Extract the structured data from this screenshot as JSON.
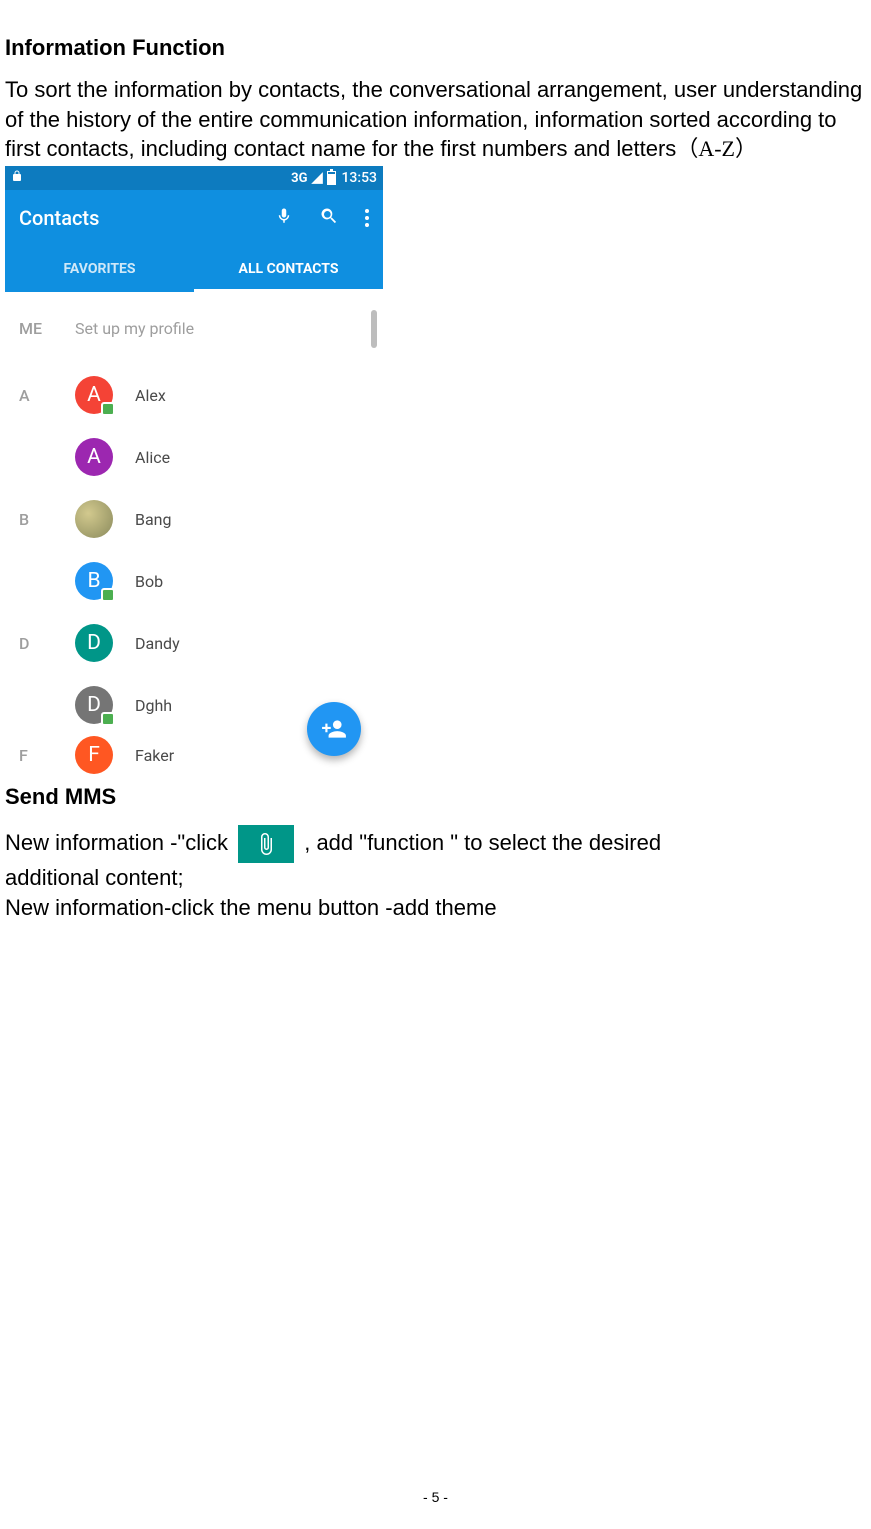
{
  "section1": {
    "heading": "Information Function",
    "paragraph": "To sort the information by contacts, the conversational arrangement, user understanding of the history of the entire communication information, information sorted according to first contacts, including contact name for the first numbers and letters",
    "az_suffix": "（A-Z）"
  },
  "phone": {
    "status": {
      "signal": "3G",
      "time": "13:53"
    },
    "app_title": "Contacts",
    "tabs": {
      "favorites": "FAVORITES",
      "all": "ALL CONTACTS"
    },
    "me_label": "ME",
    "profile_text": "Set up my profile",
    "sections": [
      {
        "letter": "A",
        "items": [
          {
            "name": "Alex",
            "color": "#f44336",
            "initial": "A",
            "badge": true
          },
          {
            "name": "Alice",
            "color": "#9c27b0",
            "initial": "A",
            "badge": false
          }
        ]
      },
      {
        "letter": "B",
        "items": [
          {
            "name": "Bang",
            "color": "#b0a77b",
            "initial": "",
            "badge": false,
            "photo": true
          },
          {
            "name": "Bob",
            "color": "#2196f3",
            "initial": "B",
            "badge": true
          }
        ]
      },
      {
        "letter": "D",
        "items": [
          {
            "name": "Dandy",
            "color": "#009688",
            "initial": "D",
            "badge": false
          },
          {
            "name": "Dghh",
            "color": "#757575",
            "initial": "D",
            "badge": true
          }
        ]
      },
      {
        "letter": "F",
        "items": [
          {
            "name": "Faker",
            "color": "#ff5722",
            "initial": "F",
            "badge": false
          }
        ]
      }
    ]
  },
  "section2": {
    "heading": "Send MMS",
    "line1_a": "New information -\"click ",
    "line1_b": " ,    add \"function    \" to select the desired",
    "line2": "additional content;",
    "line3": "New information-click the menu button -add theme"
  },
  "page_number": "- 5 -"
}
